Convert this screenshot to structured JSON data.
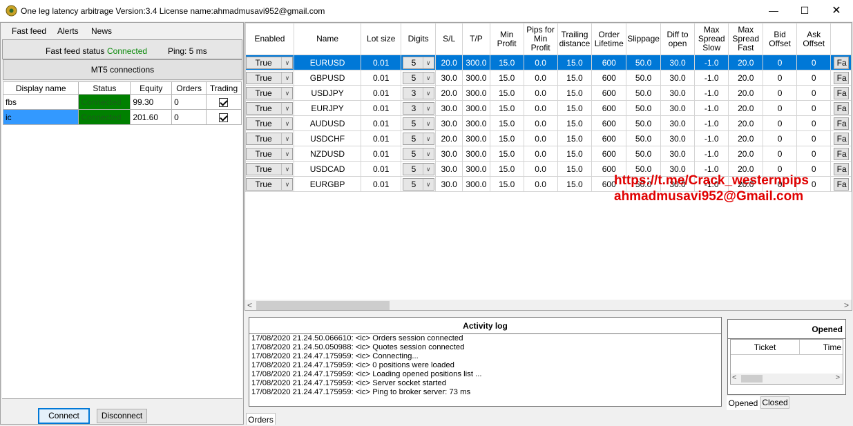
{
  "window": {
    "title": "One leg latency arbitrage Version:3.4 License name:ahmadmusavi952@gmail.com",
    "minimize": "—",
    "maximize": "☐",
    "close": "✕"
  },
  "menu": [
    "Fast feed",
    "Alerts",
    "News"
  ],
  "fast_feed": {
    "label": "Fast feed status",
    "status": "Connected",
    "ping": "Ping: 5 ms"
  },
  "mt5_button": "MT5 connections",
  "connections": {
    "columns": [
      "Display name",
      "Status",
      "Equity",
      "Orders",
      "Trading"
    ],
    "rows": [
      {
        "name": "fbs",
        "status": "Connected",
        "equity": "99.30",
        "orders": "0",
        "trading": true
      },
      {
        "name": "ic",
        "status": "Connected",
        "equity": "201.60",
        "orders": "0",
        "trading": true
      }
    ]
  },
  "buttons": {
    "connect": "Connect",
    "disconnect": "Disconnect"
  },
  "symbols": {
    "columns": [
      "Enabled",
      "Name",
      "Lot size",
      "Digits",
      "S/L",
      "T/P",
      "Min Profit",
      "Pips for Min Profit",
      "Trailing distance",
      "Order Lifetime",
      "Slippage",
      "Diff to open",
      "Max Spread Slow",
      "Max Spread Fast",
      "Bid Offset",
      "Ask Offset"
    ],
    "fa_label": "Fa",
    "rows": [
      {
        "enabled": "True",
        "name": "EURUSD",
        "lot": "0.01",
        "digits": "5",
        "sl": "20.0",
        "tp": "300.0",
        "min_profit": "15.0",
        "pips_min": "0.0",
        "trailing": "15.0",
        "lifetime": "600",
        "slippage": "50.0",
        "diff": "30.0",
        "spread_slow": "-1.0",
        "spread_fast": "20.0",
        "bid_off": "0",
        "ask_off": "0"
      },
      {
        "enabled": "True",
        "name": "GBPUSD",
        "lot": "0.01",
        "digits": "5",
        "sl": "30.0",
        "tp": "300.0",
        "min_profit": "15.0",
        "pips_min": "0.0",
        "trailing": "15.0",
        "lifetime": "600",
        "slippage": "50.0",
        "diff": "30.0",
        "spread_slow": "-1.0",
        "spread_fast": "20.0",
        "bid_off": "0",
        "ask_off": "0"
      },
      {
        "enabled": "True",
        "name": "USDJPY",
        "lot": "0.01",
        "digits": "3",
        "sl": "20.0",
        "tp": "300.0",
        "min_profit": "15.0",
        "pips_min": "0.0",
        "trailing": "15.0",
        "lifetime": "600",
        "slippage": "50.0",
        "diff": "30.0",
        "spread_slow": "-1.0",
        "spread_fast": "20.0",
        "bid_off": "0",
        "ask_off": "0"
      },
      {
        "enabled": "True",
        "name": "EURJPY",
        "lot": "0.01",
        "digits": "3",
        "sl": "30.0",
        "tp": "300.0",
        "min_profit": "15.0",
        "pips_min": "0.0",
        "trailing": "15.0",
        "lifetime": "600",
        "slippage": "50.0",
        "diff": "30.0",
        "spread_slow": "-1.0",
        "spread_fast": "20.0",
        "bid_off": "0",
        "ask_off": "0"
      },
      {
        "enabled": "True",
        "name": "AUDUSD",
        "lot": "0.01",
        "digits": "5",
        "sl": "30.0",
        "tp": "300.0",
        "min_profit": "15.0",
        "pips_min": "0.0",
        "trailing": "15.0",
        "lifetime": "600",
        "slippage": "50.0",
        "diff": "30.0",
        "spread_slow": "-1.0",
        "spread_fast": "20.0",
        "bid_off": "0",
        "ask_off": "0"
      },
      {
        "enabled": "True",
        "name": "USDCHF",
        "lot": "0.01",
        "digits": "5",
        "sl": "20.0",
        "tp": "300.0",
        "min_profit": "15.0",
        "pips_min": "0.0",
        "trailing": "15.0",
        "lifetime": "600",
        "slippage": "50.0",
        "diff": "30.0",
        "spread_slow": "-1.0",
        "spread_fast": "20.0",
        "bid_off": "0",
        "ask_off": "0"
      },
      {
        "enabled": "True",
        "name": "NZDUSD",
        "lot": "0.01",
        "digits": "5",
        "sl": "30.0",
        "tp": "300.0",
        "min_profit": "15.0",
        "pips_min": "0.0",
        "trailing": "15.0",
        "lifetime": "600",
        "slippage": "50.0",
        "diff": "30.0",
        "spread_slow": "-1.0",
        "spread_fast": "20.0",
        "bid_off": "0",
        "ask_off": "0"
      },
      {
        "enabled": "True",
        "name": "USDCAD",
        "lot": "0.01",
        "digits": "5",
        "sl": "30.0",
        "tp": "300.0",
        "min_profit": "15.0",
        "pips_min": "0.0",
        "trailing": "15.0",
        "lifetime": "600",
        "slippage": "50.0",
        "diff": "30.0",
        "spread_slow": "-1.0",
        "spread_fast": "20.0",
        "bid_off": "0",
        "ask_off": "0"
      },
      {
        "enabled": "True",
        "name": "EURGBP",
        "lot": "0.01",
        "digits": "5",
        "sl": "30.0",
        "tp": "300.0",
        "min_profit": "15.0",
        "pips_min": "0.0",
        "trailing": "15.0",
        "lifetime": "600",
        "slippage": "50.0",
        "diff": "30.0",
        "spread_slow": "-1.0",
        "spread_fast": "20.0",
        "bid_off": "0",
        "ask_off": "0"
      }
    ]
  },
  "watermark": [
    "https://t.me/Crack_westernpips",
    "ahmadmusavi952@Gmail.com"
  ],
  "activity_log": {
    "title": "Activity log",
    "lines": [
      "17/08/2020 21.24.50.066610: <ic> Orders session connected",
      "17/08/2020 21.24.50.050988: <ic> Quotes session connected",
      "17/08/2020 21.24.47.175959: <ic> Connecting...",
      "17/08/2020 21.24.47.175959: <ic> 0 positions were loaded",
      "17/08/2020 21.24.47.175959: <ic> Loading opened positions list ...",
      "17/08/2020 21.24.47.175959: <ic> Server socket started",
      "17/08/2020 21.24.47.175959: <ic> Ping to broker server: 73 ms"
    ]
  },
  "opened": {
    "title": "Opened",
    "columns": [
      "Ticket",
      "Time"
    ],
    "tabs": [
      "Opened",
      "Closed"
    ]
  },
  "bottom_tab": "Orders",
  "colors": {
    "status_green": "#008000",
    "selected_blue": "#0078d7",
    "watermark_red": "#e00000"
  }
}
